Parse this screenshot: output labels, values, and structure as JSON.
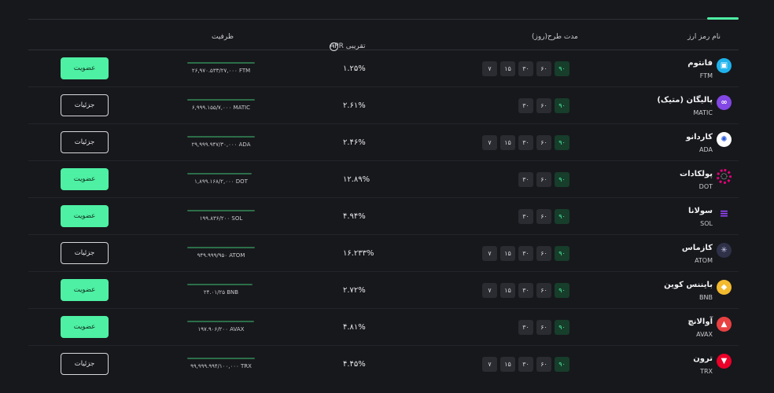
{
  "header": {
    "name": "نام رمز ارز",
    "duration": "مدت طرح(روز)",
    "apr": "APR تقریبی",
    "apr_info_icon": "info-icon",
    "capacity": "ظرفیت"
  },
  "colors": {
    "accent": "#4ef0a3",
    "active_duration_bg": "#173d2b",
    "background": "#17181c"
  },
  "rows": [
    {
      "name": "فانتوم",
      "symbol": "FTM",
      "icon": "fantom-icon",
      "icon_color": "#1fb3ec",
      "durations": [
        "۷",
        "۱۵",
        "۳۰",
        "۶۰",
        "۹۰"
      ],
      "active": "۹۰",
      "apr": "۱.۲۵%",
      "capacity": "۲۶,۹۷۰.۵۳۳/۲۷,۰۰۰ FTM",
      "capacity_fraction": 0.999,
      "action": "عضویت",
      "action_type": "join"
    },
    {
      "name": "پالیگان (متیک)",
      "symbol": "MATIC",
      "icon": "polygon-icon",
      "icon_color": "#8247e5",
      "durations": [
        "۳۰",
        "۶۰",
        "۹۰"
      ],
      "active": "۹۰",
      "apr": "۲.۶۱%",
      "capacity": "۶,۹۹۹.۱۵۵/۷,۰۰۰ MATIC",
      "capacity_fraction": 0.999,
      "action": "جزئیات",
      "action_type": "details"
    },
    {
      "name": "کاردانو",
      "symbol": "ADA",
      "icon": "cardano-icon",
      "icon_color": "#ffffff",
      "durations": [
        "۷",
        "۱۵",
        "۳۰",
        "۶۰",
        "۹۰"
      ],
      "active": "۹۰",
      "apr": "۲.۴۶%",
      "capacity": "۲۹,۹۹۹.۹۴۷/۳۰,۰۰۰ ADA",
      "capacity_fraction": 0.999,
      "action": "جزئیات",
      "action_type": "details"
    },
    {
      "name": "پولکادات",
      "symbol": "DOT",
      "icon": "polkadot-icon",
      "icon_color": "#e6007a",
      "durations": [
        "۳۰",
        "۶۰",
        "۹۰"
      ],
      "active": "۹۰",
      "apr": "۱۲.۸۹%",
      "capacity": "۱,۸۹۹.۱۶۸/۲,۰۰۰ DOT",
      "capacity_fraction": 0.95,
      "action": "عضویت",
      "action_type": "join"
    },
    {
      "name": "سولانا",
      "symbol": "SOL",
      "icon": "solana-icon",
      "icon_color": "#14f195",
      "durations": [
        "۳۰",
        "۶۰",
        "۹۰"
      ],
      "active": "۹۰",
      "apr": "۴.۹۴%",
      "capacity": "۱۹۹.۸۳۶/۲۰۰ SOL",
      "capacity_fraction": 0.999,
      "action": "عضویت",
      "action_type": "join"
    },
    {
      "name": "کازماس",
      "symbol": "ATOM",
      "icon": "cosmos-icon",
      "icon_color": "#2e3148",
      "durations": [
        "۷",
        "۱۵",
        "۳۰",
        "۶۰",
        "۹۰"
      ],
      "active": "۹۰",
      "apr": "۱۶.۲۳۳%",
      "capacity": "۹۴۹.۹۹۹/۹۵۰ ATOM",
      "capacity_fraction": 0.999,
      "action": "جزئیات",
      "action_type": "details"
    },
    {
      "name": "بایننس کوین",
      "symbol": "BNB",
      "icon": "bnb-icon",
      "icon_color": "#f3ba2f",
      "durations": [
        "۷",
        "۱۵",
        "۳۰",
        "۶۰",
        "۹۰"
      ],
      "active": "۹۰",
      "apr": "۲.۷۲%",
      "capacity": "۲۴.۰۱/۲۵ BNB",
      "capacity_fraction": 0.96,
      "action": "عضویت",
      "action_type": "join"
    },
    {
      "name": "آوالانچ",
      "symbol": "AVAX",
      "icon": "avalanche-icon",
      "icon_color": "#e84142",
      "durations": [
        "۳۰",
        "۶۰",
        "۹۰"
      ],
      "active": "۹۰",
      "apr": "۴.۸۱%",
      "capacity": "۱۹۷.۹۰۶/۲۰۰ AVAX",
      "capacity_fraction": 0.99,
      "action": "عضویت",
      "action_type": "join"
    },
    {
      "name": "ترون",
      "symbol": "TRX",
      "icon": "tron-icon",
      "icon_color": "#eb0029",
      "durations": [
        "۷",
        "۱۵",
        "۳۰",
        "۶۰",
        "۹۰"
      ],
      "active": "۹۰",
      "apr": "۴.۴۵%",
      "capacity": "۹۹,۹۹۹.۹۹۴/۱۰۰,۰۰۰ TRX",
      "capacity_fraction": 0.999,
      "action": "جزئیات",
      "action_type": "details"
    }
  ]
}
